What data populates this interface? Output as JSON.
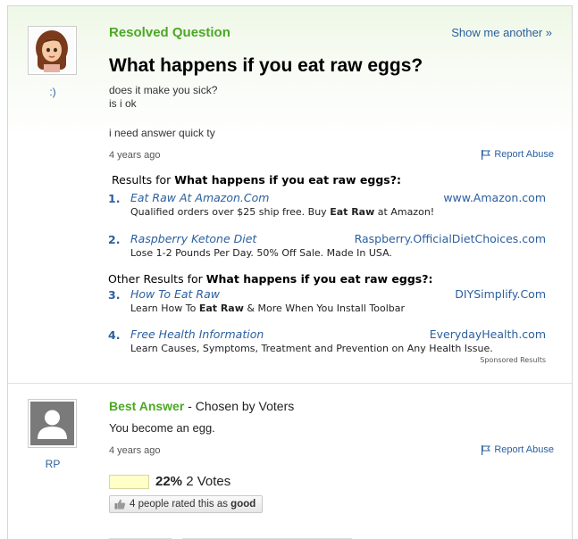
{
  "question": {
    "status_label": "Resolved Question",
    "show_another": "Show me another »",
    "asker_name": ":)",
    "title": "What happens if you eat raw eggs?",
    "body_lines": [
      "does it make you sick?",
      "is i ok",
      "i need answer quick ty"
    ],
    "age": "4 years ago",
    "report_abuse": "Report Abuse"
  },
  "ads": {
    "header1_prefix": "Results for ",
    "header1_query": "What happens if you eat raw eggs?:",
    "header2_prefix": "Other Results for ",
    "header2_query": "What happens if you eat raw eggs?:",
    "sponsored": "Sponsored Results",
    "items": [
      {
        "num": "1.",
        "title": "Eat Raw At Amazon.Com",
        "url": "www.Amazon.com",
        "desc_pre": "Qualified orders over $25 ship free. Buy ",
        "desc_bold": "Eat Raw",
        "desc_post": " at Amazon!"
      },
      {
        "num": "2.",
        "title": "Raspberry Ketone Diet",
        "url": "Raspberry.OfficialDietChoices.com",
        "desc_pre": "Lose 1-2 Pounds Per Day. 50% Off Sale. Made In USA.",
        "desc_bold": "",
        "desc_post": ""
      },
      {
        "num": "3.",
        "title": "How To Eat Raw",
        "url": "DIYSimplify.Com",
        "desc_pre": "Learn How To ",
        "desc_bold": "Eat Raw",
        "desc_post": " & More When You Install Toolbar"
      },
      {
        "num": "4.",
        "title": "Free Health Information",
        "url": "EverydayHealth.com",
        "desc_pre": "Learn Causes, Symptoms, Treatment and Prevention on Any Health Issue.",
        "desc_bold": "",
        "desc_post": ""
      }
    ]
  },
  "best_answer": {
    "label": "Best Answer",
    "chosen_by": " - Chosen by Voters",
    "answerer_name": "RP",
    "text": "You become an egg.",
    "age": "4 years ago",
    "report_abuse": "Report Abuse",
    "vote_percent": "22%",
    "vote_fraction": 0.22,
    "votes": "2 Votes",
    "rated_pre": "4 people rated this as ",
    "rated_bold": "good"
  },
  "colors": {
    "accent_green": "#4ca825",
    "link_blue": "#2b5f9f"
  }
}
